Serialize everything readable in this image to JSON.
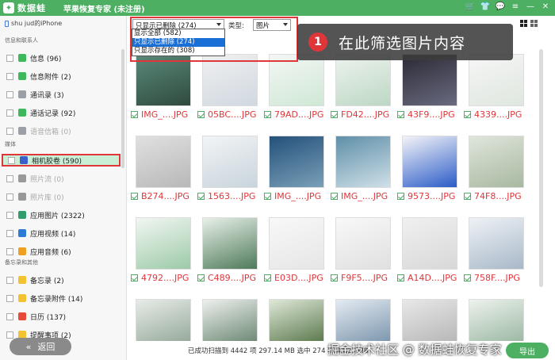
{
  "titlebar": {
    "brand": "数据蛙",
    "app_title": "苹果恢复专家 (未注册)",
    "icons": [
      "cart-icon",
      "shirt-icon",
      "chat-icon",
      "menu-icon",
      "minimize-icon",
      "close-icon"
    ]
  },
  "sidebar": {
    "device": "shu jud的iPhone",
    "section_messages": "信息和联系人",
    "section_media": "媒体",
    "section_notes": "备忘录和其他",
    "items_messages": [
      {
        "label": "信息 (96)",
        "color": "#3db85a",
        "disabled": false
      },
      {
        "label": "信息附件 (2)",
        "color": "#3db85a",
        "disabled": false
      },
      {
        "label": "通讯录 (3)",
        "color": "#9aa0a6",
        "disabled": false
      },
      {
        "label": "通话记录 (92)",
        "color": "#3db85a",
        "disabled": false
      },
      {
        "label": "语音信箱 (0)",
        "color": "#9aa0a6",
        "disabled": true
      }
    ],
    "items_media": [
      {
        "label": "相机胶卷 (590)",
        "color": "#3a5fcd",
        "selected": true
      },
      {
        "label": "照片流 (0)",
        "color": "#999999",
        "disabled": true
      },
      {
        "label": "照片库 (0)",
        "color": "#999999",
        "disabled": true
      },
      {
        "label": "应用图片 (2322)",
        "color": "#2f9e6a"
      },
      {
        "label": "应用视频 (14)",
        "color": "#2e7bd6"
      },
      {
        "label": "应用音频 (6)",
        "color": "#f0a020"
      }
    ],
    "items_notes": [
      {
        "label": "备忘录 (2)",
        "color": "#f2c230"
      },
      {
        "label": "备忘录附件 (14)",
        "color": "#f2c230"
      },
      {
        "label": "日历 (137)",
        "color": "#e84a3a"
      },
      {
        "label": "提醒事项 (2)",
        "color": "#f2c230"
      }
    ],
    "back_label": "返回"
  },
  "toolbar": {
    "filter_value": "只显示已删除 (274)",
    "type_label": "类型:",
    "type_value": "图片",
    "dropdown_options": [
      "显示全部 (582)",
      "只显示已删除 (274)",
      "只显示存在的 (308)"
    ],
    "dropdown_active_index": 1
  },
  "callout": {
    "number": "1",
    "text": "在此筛选图片内容"
  },
  "files": [
    "IMG_....JPG",
    "05BC....JPG",
    "79AD....JPG",
    "FD42....JPG",
    "43F9....JPG",
    "4339....JPG",
    "B274....JPG",
    "1563....JPG",
    "IMG_....JPG",
    "IMG_....JPG",
    "9573....JPG",
    "74F8....JPG",
    "4792....JPG",
    "C489....JPG",
    "E03D....JPG",
    "F9F5....JPG",
    "A14D....JPG",
    "758F....JPG",
    "",
    "",
    "",
    "",
    "",
    ""
  ],
  "status": {
    "text": "已成功扫描到 4442 项 297.14 MB  选中 274 项 43.23 MB",
    "watermark": "掘金技术社区 @ 数据蛙恢复专家",
    "export_label": "导出"
  },
  "colors": {
    "accent": "#4caf62",
    "highlight": "#e0363a",
    "selected_bg": "#c9f0d6",
    "dropdown_active": "#1a6fd6"
  }
}
